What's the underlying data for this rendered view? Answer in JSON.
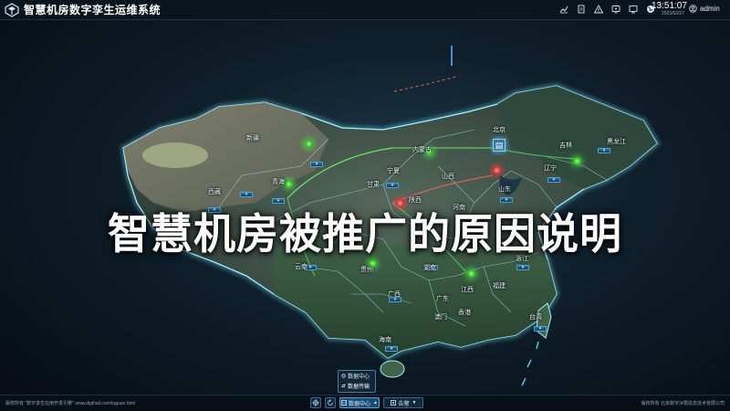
{
  "app": {
    "title": "智慧机房数字孪生运维系统"
  },
  "header": {
    "icons": [
      "chart-line-icon",
      "document-icon",
      "warning-icon",
      "monitor-icon",
      "display-icon",
      "globe-icon"
    ],
    "time": "13:51:07",
    "date": "2023/02/27",
    "user": "admin"
  },
  "overlay": {
    "title": "智慧机房被推广的原因说明"
  },
  "map": {
    "labels": {
      "xinjiang": "新疆",
      "xizang": "西藏",
      "qinghai": "青海",
      "gansu": "甘肃",
      "neimenggu": "内蒙古",
      "ningxia": "宁夏",
      "shaanxi": "陕西",
      "shanxi": "山西",
      "beijing": "北京",
      "heilongjiang": "黑龙江",
      "jilin": "吉林",
      "liaoning": "辽宁",
      "shandong": "山东",
      "henan": "河南",
      "sichuan": "四川",
      "yunnan": "云南",
      "guizhou": "贵州",
      "hunan": "湖南",
      "jiangxi": "江西",
      "zhejiang": "浙江",
      "fujian": "福建",
      "guangxi": "广西",
      "guangdong": "广东",
      "aomen": "澳门",
      "xianggang": "香港",
      "taiwan": "台湾",
      "hainan": "海南"
    }
  },
  "popup": {
    "items": [
      "数据中心",
      "数据传输"
    ]
  },
  "footer": {
    "left": "版权所有 \"数字孪生应用开发引擎\" www.digihail.com/tuguan.html",
    "right": "版权所有 北京数字冰雹信息技术有限公司",
    "dropdown1": "数据中心",
    "dropdown2": "告警"
  },
  "colors": {
    "accent": "#3f9fd8",
    "alert": "#e03030",
    "ok": "#2fbf2a",
    "border": "#79e8ff"
  }
}
